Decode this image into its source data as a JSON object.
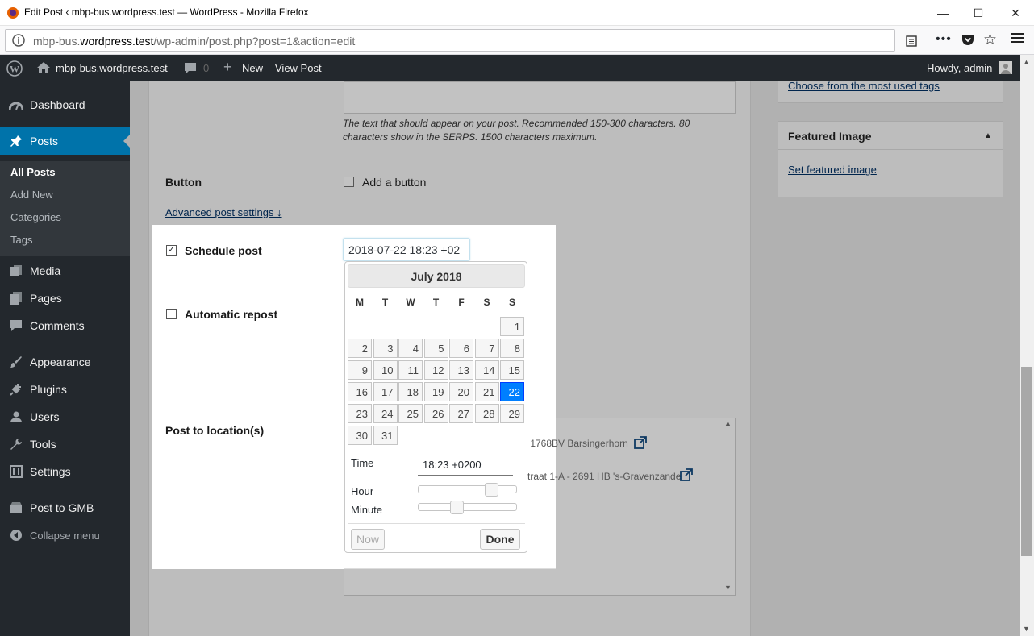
{
  "browser": {
    "title": "Edit Post ‹ mbp-bus.wordpress.test — WordPress - Mozilla Firefox",
    "url_prefix": "mbp-bus.",
    "url_domain": "wordpress.test",
    "url_path": "/wp-admin/post.php?post=1&action=edit"
  },
  "adminbar": {
    "site": "mbp-bus.wordpress.test",
    "comments_count": "0",
    "new_label": "New",
    "view_post": "View Post",
    "howdy": "Howdy, admin"
  },
  "menu": {
    "dashboard": "Dashboard",
    "posts": "Posts",
    "all_posts": "All Posts",
    "add_new": "Add New",
    "categories": "Categories",
    "tags": "Tags",
    "media": "Media",
    "pages": "Pages",
    "comments": "Comments",
    "appearance": "Appearance",
    "plugins": "Plugins",
    "users": "Users",
    "tools": "Tools",
    "settings": "Settings",
    "post_to_gmb": "Post to GMB",
    "collapse": "Collapse menu"
  },
  "form": {
    "help_text": "The text that should appear on your post. Recommended 150-300 characters. 80 characters show in the SERPS. 1500 characters maximum.",
    "button_label": "Button",
    "add_button": "Add a button",
    "advanced_link": "Advanced post settings ↓",
    "schedule_label": "Schedule post",
    "schedule_checked": true,
    "schedule_value": "2018-07-22 18:23 +02",
    "auto_repost": "Automatic repost",
    "post_to_location": "Post to location(s)",
    "location_1": "- 1768BV Barsingerhorn",
    "location_2": "traat 1-A - 2691 HB 's-Gravenzande"
  },
  "side": {
    "most_used_tags": "Choose from the most used tags",
    "featured_title": "Featured Image",
    "set_featured": "Set featured image"
  },
  "datepicker": {
    "month_title": "July 2018",
    "weekdays": [
      "M",
      "T",
      "W",
      "T",
      "F",
      "S",
      "S"
    ],
    "selected_day": 22,
    "time_label": "Time",
    "time_value": "18:23 +0200",
    "hour_label": "Hour",
    "minute_label": "Minute",
    "hour_fraction": 0.78,
    "minute_fraction": 0.38,
    "now_btn": "Now",
    "done_btn": "Done"
  }
}
